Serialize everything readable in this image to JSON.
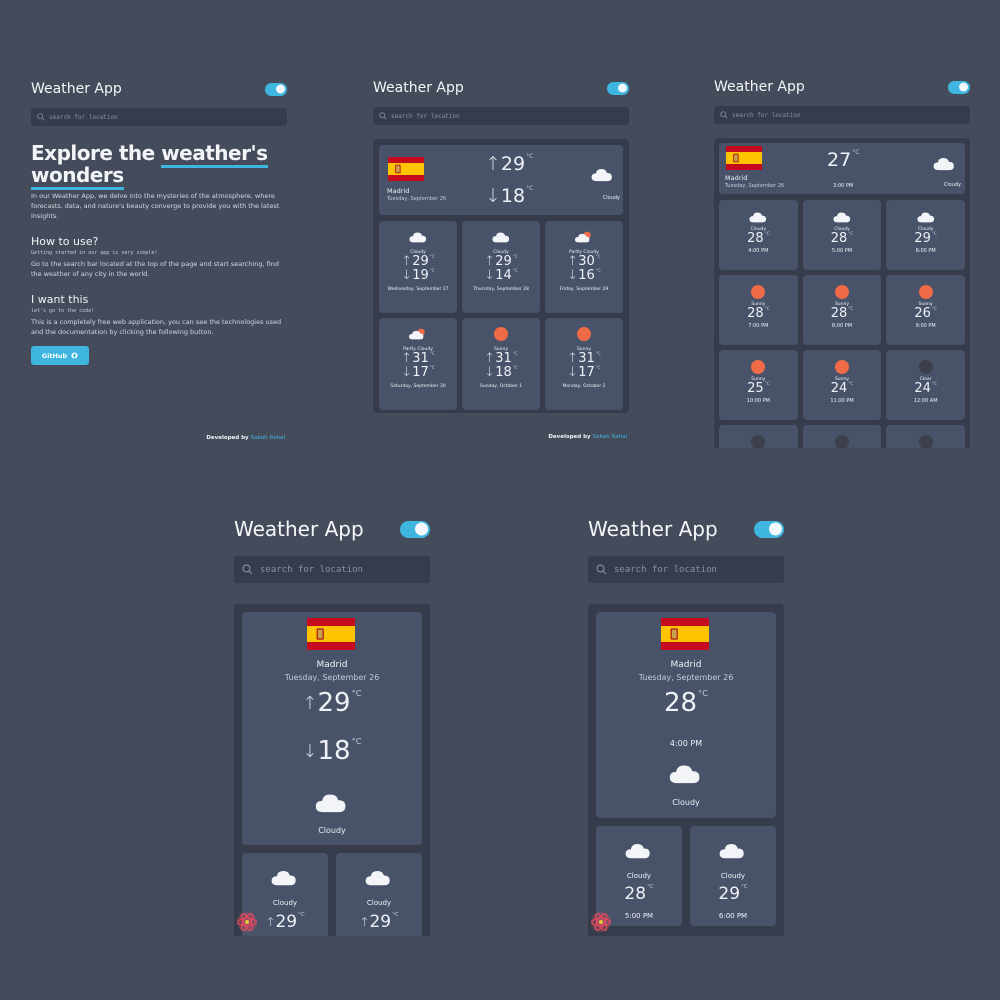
{
  "app_title": "Weather App",
  "search_placeholder": "search for location",
  "landing": {
    "headline_part1": "Explore the ",
    "headline_highlight": "weather's",
    "headline_part2": "wonders",
    "intro": "In our Weather App, we delve into the mysteries of the atmosphere, where forecasts, data, and nature's beauty converge to provide you with the latest insights.",
    "howto_title": "How to use?",
    "howto_code": "Getting started in our app is very simple!",
    "howto_text": "Go to the search bar located at the top of the page and start searching, find the weather of any city in the world.",
    "want_title": "I want this",
    "want_code": "let's go to the code!",
    "want_text": "This is a completely free web application, you can see the technologies used and the documentation by clicking the following button.",
    "github_label": "GitHub",
    "footer_prefix": "Developed by",
    "footer_author": "Sabah Rahal"
  },
  "current": {
    "city": "Madrid",
    "date": "Tuesday, September 26",
    "high": "29",
    "low": "18",
    "condition": "Cloudy",
    "unit": "°C",
    "hourly_temp": "27",
    "hourly_time": "3:00 PM"
  },
  "daily": [
    {
      "condition": "Cloudy",
      "high": "29",
      "low": "19",
      "date": "Wednesday, September 27",
      "icon": "cloud-icon"
    },
    {
      "condition": "Cloudy",
      "high": "29",
      "low": "14",
      "date": "Thursday, September 28",
      "icon": "cloud-icon"
    },
    {
      "condition": "Partly Cloudy",
      "high": "30",
      "low": "16",
      "date": "Friday, September 29",
      "icon": "partly-cloudy-icon"
    },
    {
      "condition": "Partly Cloudy",
      "high": "31",
      "low": "17",
      "date": "Saturday, September 30",
      "icon": "partly-cloudy-icon"
    },
    {
      "condition": "Sunny",
      "high": "31",
      "low": "18",
      "date": "Sunday, October 1",
      "icon": "sun-icon"
    },
    {
      "condition": "Sunny",
      "high": "31",
      "low": "17",
      "date": "Monday, October 2",
      "icon": "sun-icon"
    }
  ],
  "hourly": [
    {
      "condition": "Cloudy",
      "temp": "28",
      "time": "4:00 PM",
      "icon": "cloud-icon"
    },
    {
      "condition": "Cloudy",
      "temp": "28",
      "time": "5:00 PM",
      "icon": "cloud-icon"
    },
    {
      "condition": "Cloudy",
      "temp": "29",
      "time": "6:00 PM",
      "icon": "cloud-icon"
    },
    {
      "condition": "Sunny",
      "temp": "28",
      "time": "7:00 PM",
      "icon": "sun-icon"
    },
    {
      "condition": "Sunny",
      "temp": "28",
      "time": "8:00 PM",
      "icon": "sun-icon"
    },
    {
      "condition": "Sunny",
      "temp": "26",
      "time": "9:00 PM",
      "icon": "sun-icon"
    },
    {
      "condition": "Sunny",
      "temp": "25",
      "time": "10:00 PM",
      "icon": "sun-icon"
    },
    {
      "condition": "Sunny",
      "temp": "24",
      "time": "11:00 PM",
      "icon": "sun-icon"
    },
    {
      "condition": "Clear",
      "temp": "24",
      "time": "12:00 AM",
      "icon": "moon-icon"
    }
  ],
  "mobile_left": {
    "small_cards": [
      {
        "condition": "Cloudy",
        "high": "29"
      },
      {
        "condition": "Cloudy",
        "high": "29"
      }
    ]
  },
  "mobile_right": {
    "main_temp": "28",
    "main_time": "4:00 PM",
    "main_condition": "Cloudy",
    "small_cards": [
      {
        "condition": "Cloudy",
        "temp": "28",
        "time": "5:00 PM"
      },
      {
        "condition": "Cloudy",
        "temp": "29",
        "time": "6:00 PM"
      }
    ]
  },
  "colors": {
    "background": "#444c5c",
    "board": "#363c4b",
    "card": "#48536a",
    "accent": "#3fb6e0",
    "sun": "#ef6a47"
  }
}
